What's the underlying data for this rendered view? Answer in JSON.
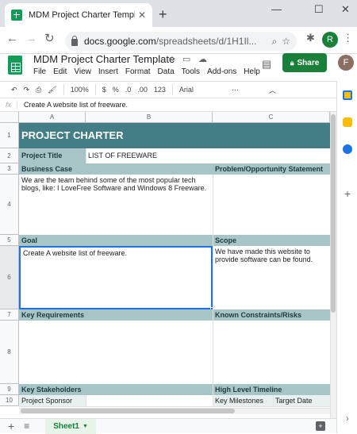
{
  "browser": {
    "tab_title": "MDM Project Charter Template -",
    "url_domain": "docs.google.com",
    "url_path": "/spreadsheets/d/1H1Il...",
    "profile_initial": "R"
  },
  "sheets": {
    "doc_title": "MDM Project Charter Template",
    "menu": [
      "File",
      "Edit",
      "View",
      "Insert",
      "Format",
      "Data",
      "Tools",
      "Add-ons",
      "Help"
    ],
    "share_label": "Share",
    "user_initial": "F",
    "toolbar": {
      "zoom": "100%",
      "currency": "$",
      "percent": "%",
      "dec_less": ".0",
      "dec_more": ".00",
      "num_format": "123",
      "font": "Arial"
    },
    "formula_text": "Create A website list of freeware.",
    "columns": [
      "A",
      "B",
      "C"
    ],
    "rows": [
      "1",
      "2",
      "3",
      "4",
      "5",
      "6",
      "7",
      "8",
      "9",
      "10"
    ],
    "cells": {
      "title": "PROJECT CHARTER",
      "project_title_label": "Project Title",
      "project_title_value": "LIST OF FREEWARE",
      "business_case": "Business Case",
      "problem_statement": "Problem/Opportunity Statement",
      "business_case_text": "We are the team behind some of the most popular tech blogs, like: I LoveFree Software and Windows 8 Freeware.",
      "goal": "Goal",
      "scope": "Scope",
      "goal_text": "Create A website list of freeware.",
      "scope_text": "We have made this website to provide software can be found.",
      "key_requirements": "Key Requirements",
      "constraints": "Known Constraints/Risks",
      "stakeholders": "Key Stakeholders",
      "timeline": "High Level Timeline",
      "project_sponsor": "Project Sponsor",
      "key_milestones": "Key Milestones",
      "target_date": "Target Date"
    },
    "sheet_tab": "Sheet1",
    "colors": {
      "title_band": "#437e86",
      "section_band": "#a7c4c6",
      "share": "#188038"
    }
  }
}
